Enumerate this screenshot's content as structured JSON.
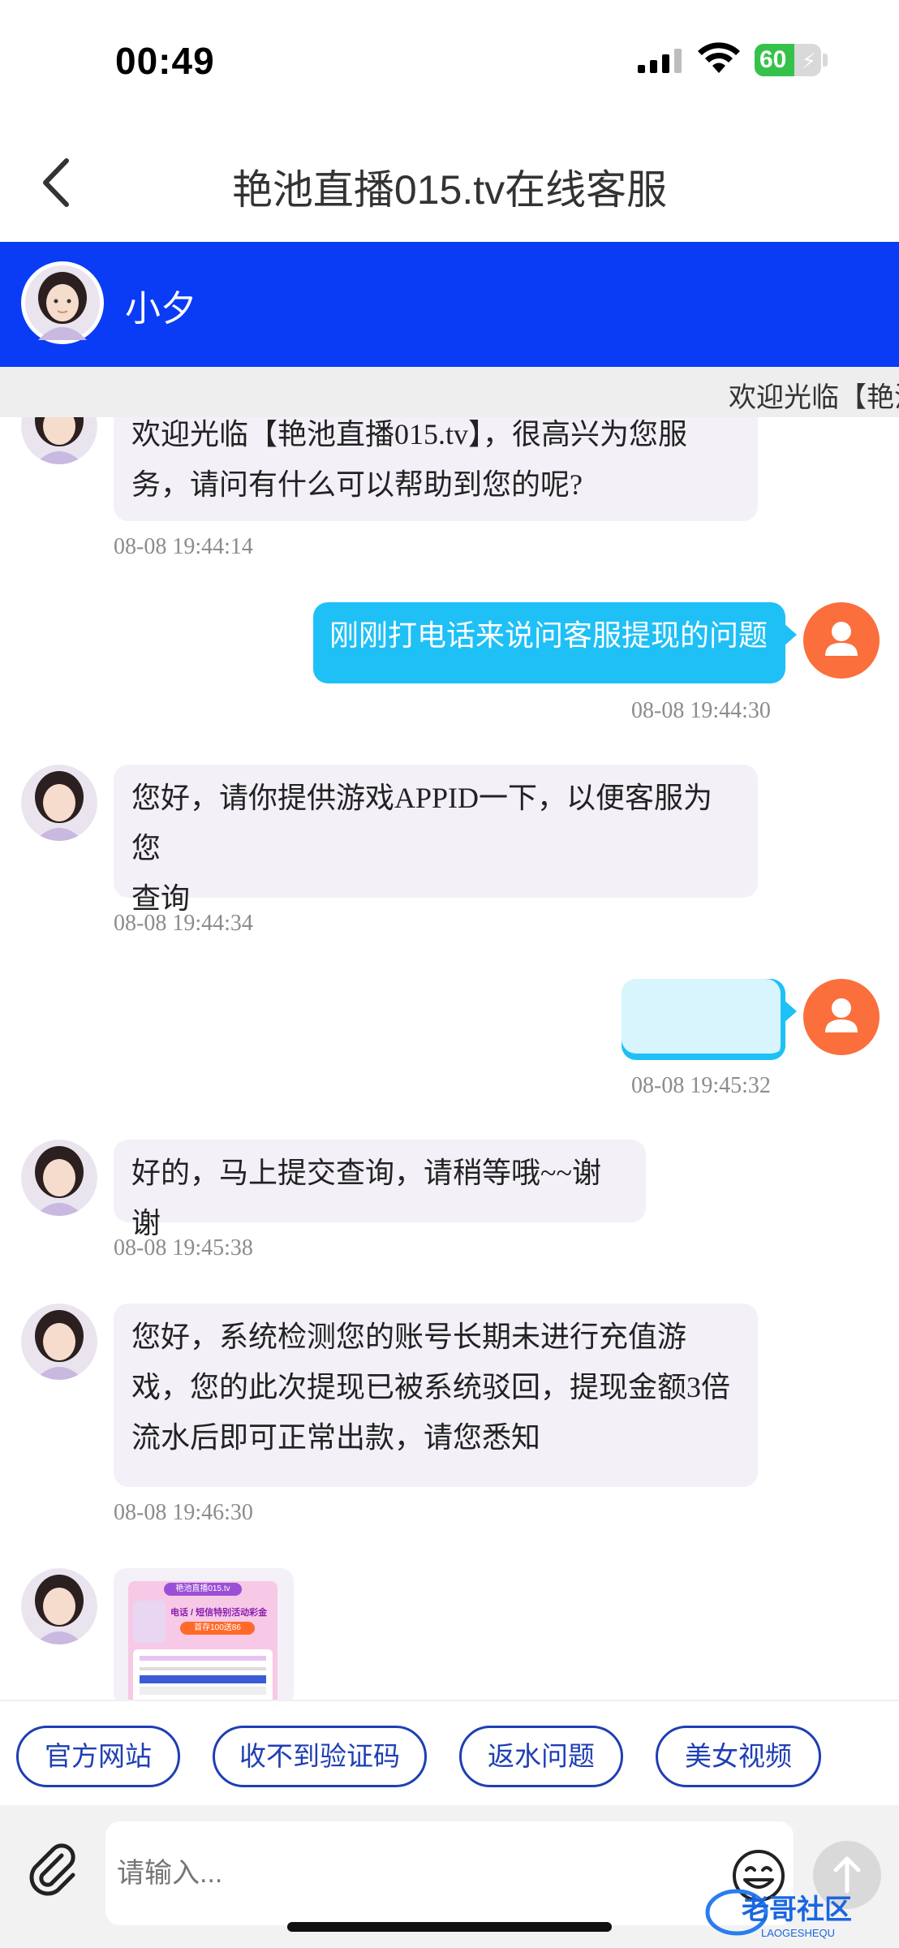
{
  "status_bar": {
    "time": "00:49",
    "battery": "60"
  },
  "nav": {
    "title": "艳池直播015.tv在线客服"
  },
  "agent": {
    "name": "小夕"
  },
  "marquee": {
    "text": "欢迎光临【艳池"
  },
  "messages": [
    {
      "from": "agent",
      "text": "欢迎光临【艳池直播015.tv】，很高兴为您服务，请问有什么可以帮助到您的呢?",
      "line1": "欢迎光临【艳池直播015.tv】，很高兴为您服",
      "line2": "务，请问有什么可以帮助到您的呢?",
      "time": "08-08 19:44:14"
    },
    {
      "from": "user",
      "text": "刚刚打电话来说问客服提现的问题",
      "time": "08-08 19:44:30"
    },
    {
      "from": "agent",
      "line1": "您好，请你提供游戏APPID一下，以便客服为您",
      "line2": "查询",
      "time": "08-08 19:44:34"
    },
    {
      "from": "user",
      "text": "",
      "time": "08-08 19:45:32"
    },
    {
      "from": "agent",
      "line1": "好的，马上提交查询，请稍等哦~~谢谢",
      "time": "08-08 19:45:38"
    },
    {
      "from": "agent",
      "line1": "您好，系统检测您的账号长期未进行充值游",
      "line2": "戏，您的此次提现已被系统驳回，提现金额3倍",
      "line3": "流水后即可正常出款，请您悉知",
      "time": "08-08 19:46:30"
    },
    {
      "from": "agent",
      "type": "image",
      "image_caption": "艳池直播015.tv",
      "image_heading": "电话 / 短信特别活动彩金",
      "image_badge": "首存100送86"
    }
  ],
  "quick_replies": [
    "官方网站",
    "收不到验证码",
    "返水问题",
    "美女视频"
  ],
  "input": {
    "placeholder": "请输入..."
  },
  "watermark": {
    "text": "老哥社区",
    "sub": "LAOGESHEQU"
  },
  "colors": {
    "brand_blue": "#0a3cf5",
    "user_bubble": "#1fc0f5",
    "agent_bubble": "#f3f0f7",
    "user_avatar": "#fa6f3c",
    "chip_border": "#1f3fb3"
  }
}
